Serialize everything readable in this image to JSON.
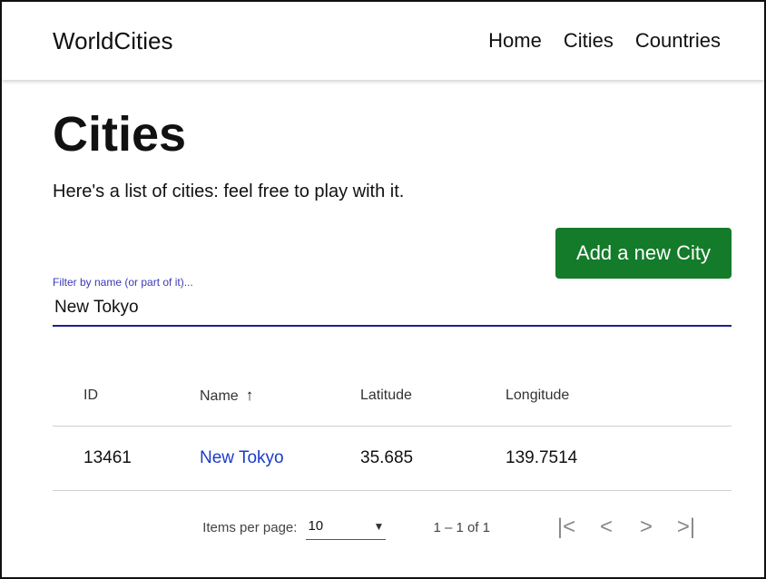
{
  "app": {
    "brand": "WorldCities",
    "nav": [
      {
        "label": "Home"
      },
      {
        "label": "Cities"
      },
      {
        "label": "Countries"
      }
    ]
  },
  "page": {
    "title": "Cities",
    "subtitle": "Here's a list of cities: feel free to play with it.",
    "add_button_label": "Add a new City"
  },
  "filter": {
    "label": "Filter by name (or part of it)...",
    "value": "New Tokyo"
  },
  "table": {
    "headers": {
      "id": "ID",
      "name": "Name",
      "latitude": "Latitude",
      "longitude": "Longitude"
    },
    "sort_indicator": "↑",
    "rows": [
      {
        "id": "13461",
        "name": "New Tokyo",
        "latitude": "35.685",
        "longitude": "139.7514"
      }
    ]
  },
  "paginator": {
    "items_per_page_label": "Items per page:",
    "items_per_page_value": "10",
    "range": "1 – 1 of 1",
    "first_icon": "first-page-icon",
    "prev_icon": "chevron-left-icon",
    "next_icon": "chevron-right-icon",
    "last_icon": "last-page-icon"
  },
  "colors": {
    "add_button": "#137b2a",
    "link": "#1a3cc8",
    "filter_accent": "#1f1f8e"
  }
}
